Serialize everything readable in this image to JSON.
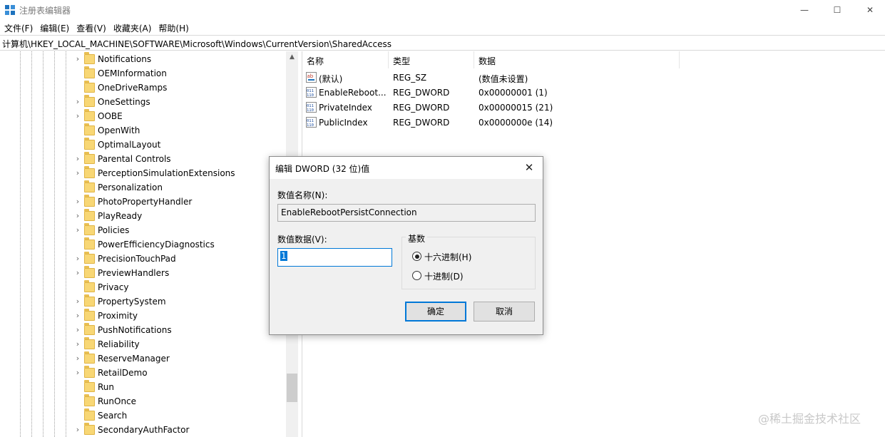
{
  "window": {
    "title": "注册表编辑器",
    "controls": {
      "minimize": "—",
      "maximize": "☐",
      "close": "✕"
    }
  },
  "menu": [
    "文件(F)",
    "编辑(E)",
    "查看(V)",
    "收藏夹(A)",
    "帮助(H)"
  ],
  "address": "计算机\\HKEY_LOCAL_MACHINE\\SOFTWARE\\Microsoft\\Windows\\CurrentVersion\\SharedAccess",
  "tree": {
    "items": [
      {
        "label": "Notifications",
        "expandable": true
      },
      {
        "label": "OEMInformation",
        "expandable": false
      },
      {
        "label": "OneDriveRamps",
        "expandable": false
      },
      {
        "label": "OneSettings",
        "expandable": true
      },
      {
        "label": "OOBE",
        "expandable": true
      },
      {
        "label": "OpenWith",
        "expandable": false
      },
      {
        "label": "OptimalLayout",
        "expandable": false
      },
      {
        "label": "Parental Controls",
        "expandable": true
      },
      {
        "label": "PerceptionSimulationExtensions",
        "expandable": true
      },
      {
        "label": "Personalization",
        "expandable": false
      },
      {
        "label": "PhotoPropertyHandler",
        "expandable": true
      },
      {
        "label": "PlayReady",
        "expandable": true
      },
      {
        "label": "Policies",
        "expandable": true
      },
      {
        "label": "PowerEfficiencyDiagnostics",
        "expandable": false
      },
      {
        "label": "PrecisionTouchPad",
        "expandable": true
      },
      {
        "label": "PreviewHandlers",
        "expandable": true
      },
      {
        "label": "Privacy",
        "expandable": false
      },
      {
        "label": "PropertySystem",
        "expandable": true
      },
      {
        "label": "Proximity",
        "expandable": true
      },
      {
        "label": "PushNotifications",
        "expandable": true
      },
      {
        "label": "Reliability",
        "expandable": true
      },
      {
        "label": "ReserveManager",
        "expandable": true
      },
      {
        "label": "RetailDemo",
        "expandable": true
      },
      {
        "label": "Run",
        "expandable": false
      },
      {
        "label": "RunOnce",
        "expandable": false
      },
      {
        "label": "Search",
        "expandable": false
      },
      {
        "label": "SecondaryAuthFactor",
        "expandable": true
      }
    ]
  },
  "list": {
    "headers": {
      "name": "名称",
      "type": "类型",
      "data": "数据"
    },
    "rows": [
      {
        "icon": "string-value-icon",
        "name": "(默认)",
        "type": "REG_SZ",
        "data": "(数值未设置)"
      },
      {
        "icon": "binary-value-icon",
        "name": "EnableReboot...",
        "type": "REG_DWORD",
        "data": "0x00000001 (1)"
      },
      {
        "icon": "binary-value-icon",
        "name": "PrivateIndex",
        "type": "REG_DWORD",
        "data": "0x00000015 (21)"
      },
      {
        "icon": "binary-value-icon",
        "name": "PublicIndex",
        "type": "REG_DWORD",
        "data": "0x0000000e (14)"
      }
    ]
  },
  "dialog": {
    "title": "编辑 DWORD (32 位)值",
    "close": "✕",
    "name_label": "数值名称(N):",
    "name_value": "EnableRebootPersistConnection",
    "data_label": "数值数据(V):",
    "data_value": "1",
    "base_label": "基数",
    "hex_label": "十六进制(H)",
    "dec_label": "十进制(D)",
    "ok_label": "确定",
    "cancel_label": "取消"
  },
  "watermark": "@稀土掘金技术社区"
}
